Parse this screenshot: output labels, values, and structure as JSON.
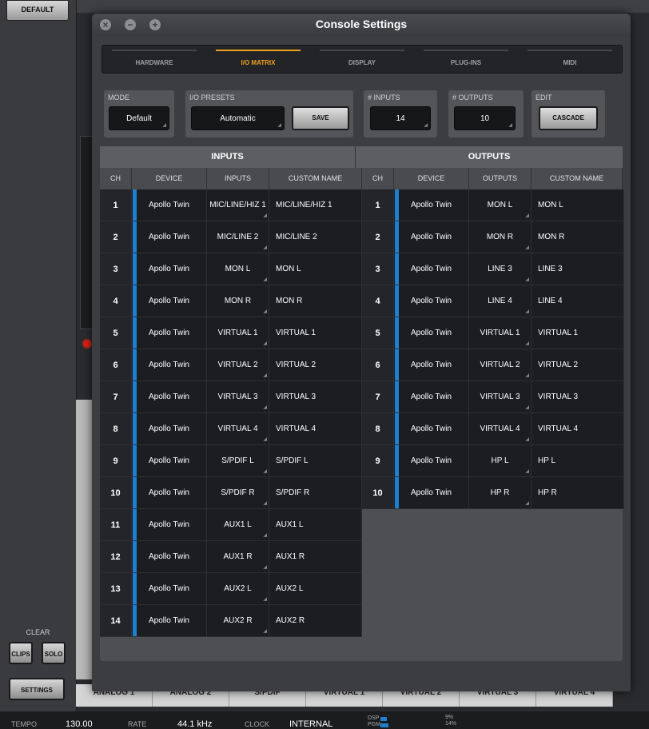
{
  "background": {
    "default_label": "DEFAULT",
    "clear_label": "CLEAR",
    "clips_label": "CLIPS",
    "solo_label": "SOLO",
    "settings_label": "SETTINGS",
    "channels": [
      "ANALOG 1",
      "ANALOG 2",
      "S/PDIF",
      "VIRTUAL 1",
      "VIRTUAL 2",
      "VIRTUAL 3",
      "VIRTUAL 4"
    ],
    "status": {
      "tempo_label": "TEMPO",
      "tempo_value": "130.00",
      "rate_label": "RATE",
      "rate_value": "44.1 kHz",
      "clock_label": "CLOCK",
      "clock_value": "INTERNAL",
      "dsp_label": "DSP",
      "dsp_value": "9%",
      "pgm_label": "PGM",
      "pgm_value": "14%"
    }
  },
  "window": {
    "title": "Console Settings",
    "tabs": [
      {
        "label": "HARDWARE",
        "active": false
      },
      {
        "label": "I/O MATRIX",
        "active": true
      },
      {
        "label": "DISPLAY",
        "active": false
      },
      {
        "label": "PLUG-INS",
        "active": false
      },
      {
        "label": "MIDI",
        "active": false
      }
    ],
    "controls": {
      "mode_label": "MODE",
      "mode_value": "Default",
      "presets_label": "I/O PRESETS",
      "presets_value": "Automatic",
      "save_label": "SAVE",
      "inputs_label": "# INPUTS",
      "inputs_value": "14",
      "outputs_label": "# OUTPUTS",
      "outputs_value": "10",
      "edit_label": "EDIT",
      "cascade_label": "CASCADE"
    },
    "inputs": {
      "title": "INPUTS",
      "columns": [
        "CH",
        "DEVICE",
        "INPUTS",
        "CUSTOM NAME"
      ],
      "rows": [
        {
          "ch": "1",
          "device": "Apollo Twin",
          "io": "MIC/LINE/HIZ 1",
          "name": "MIC/LINE/HIZ 1"
        },
        {
          "ch": "2",
          "device": "Apollo Twin",
          "io": "MIC/LINE 2",
          "name": "MIC/LINE 2"
        },
        {
          "ch": "3",
          "device": "Apollo Twin",
          "io": "MON L",
          "name": "MON L"
        },
        {
          "ch": "4",
          "device": "Apollo Twin",
          "io": "MON R",
          "name": "MON R"
        },
        {
          "ch": "5",
          "device": "Apollo Twin",
          "io": "VIRTUAL 1",
          "name": "VIRTUAL 1"
        },
        {
          "ch": "6",
          "device": "Apollo Twin",
          "io": "VIRTUAL 2",
          "name": "VIRTUAL 2"
        },
        {
          "ch": "7",
          "device": "Apollo Twin",
          "io": "VIRTUAL 3",
          "name": "VIRTUAL 3"
        },
        {
          "ch": "8",
          "device": "Apollo Twin",
          "io": "VIRTUAL 4",
          "name": "VIRTUAL 4"
        },
        {
          "ch": "9",
          "device": "Apollo Twin",
          "io": "S/PDIF L",
          "name": "S/PDIF L"
        },
        {
          "ch": "10",
          "device": "Apollo Twin",
          "io": "S/PDIF R",
          "name": "S/PDIF R"
        },
        {
          "ch": "11",
          "device": "Apollo Twin",
          "io": "AUX1 L",
          "name": "AUX1 L"
        },
        {
          "ch": "12",
          "device": "Apollo Twin",
          "io": "AUX1 R",
          "name": "AUX1 R"
        },
        {
          "ch": "13",
          "device": "Apollo Twin",
          "io": "AUX2 L",
          "name": "AUX2 L"
        },
        {
          "ch": "14",
          "device": "Apollo Twin",
          "io": "AUX2 R",
          "name": "AUX2 R"
        }
      ]
    },
    "outputs": {
      "title": "OUTPUTS",
      "columns": [
        "CH",
        "DEVICE",
        "OUTPUTS",
        "CUSTOM NAME"
      ],
      "rows": [
        {
          "ch": "1",
          "device": "Apollo Twin",
          "io": "MON L",
          "name": "MON L"
        },
        {
          "ch": "2",
          "device": "Apollo Twin",
          "io": "MON R",
          "name": "MON R"
        },
        {
          "ch": "3",
          "device": "Apollo Twin",
          "io": "LINE 3",
          "name": "LINE 3"
        },
        {
          "ch": "4",
          "device": "Apollo Twin",
          "io": "LINE 4",
          "name": "LINE 4"
        },
        {
          "ch": "5",
          "device": "Apollo Twin",
          "io": "VIRTUAL 1",
          "name": "VIRTUAL 1"
        },
        {
          "ch": "6",
          "device": "Apollo Twin",
          "io": "VIRTUAL 2",
          "name": "VIRTUAL 2"
        },
        {
          "ch": "7",
          "device": "Apollo Twin",
          "io": "VIRTUAL 3",
          "name": "VIRTUAL 3"
        },
        {
          "ch": "8",
          "device": "Apollo Twin",
          "io": "VIRTUAL 4",
          "name": "VIRTUAL 4"
        },
        {
          "ch": "9",
          "device": "Apollo Twin",
          "io": "HP L",
          "name": "HP L"
        },
        {
          "ch": "10",
          "device": "Apollo Twin",
          "io": "HP R",
          "name": "HP R"
        }
      ]
    }
  }
}
